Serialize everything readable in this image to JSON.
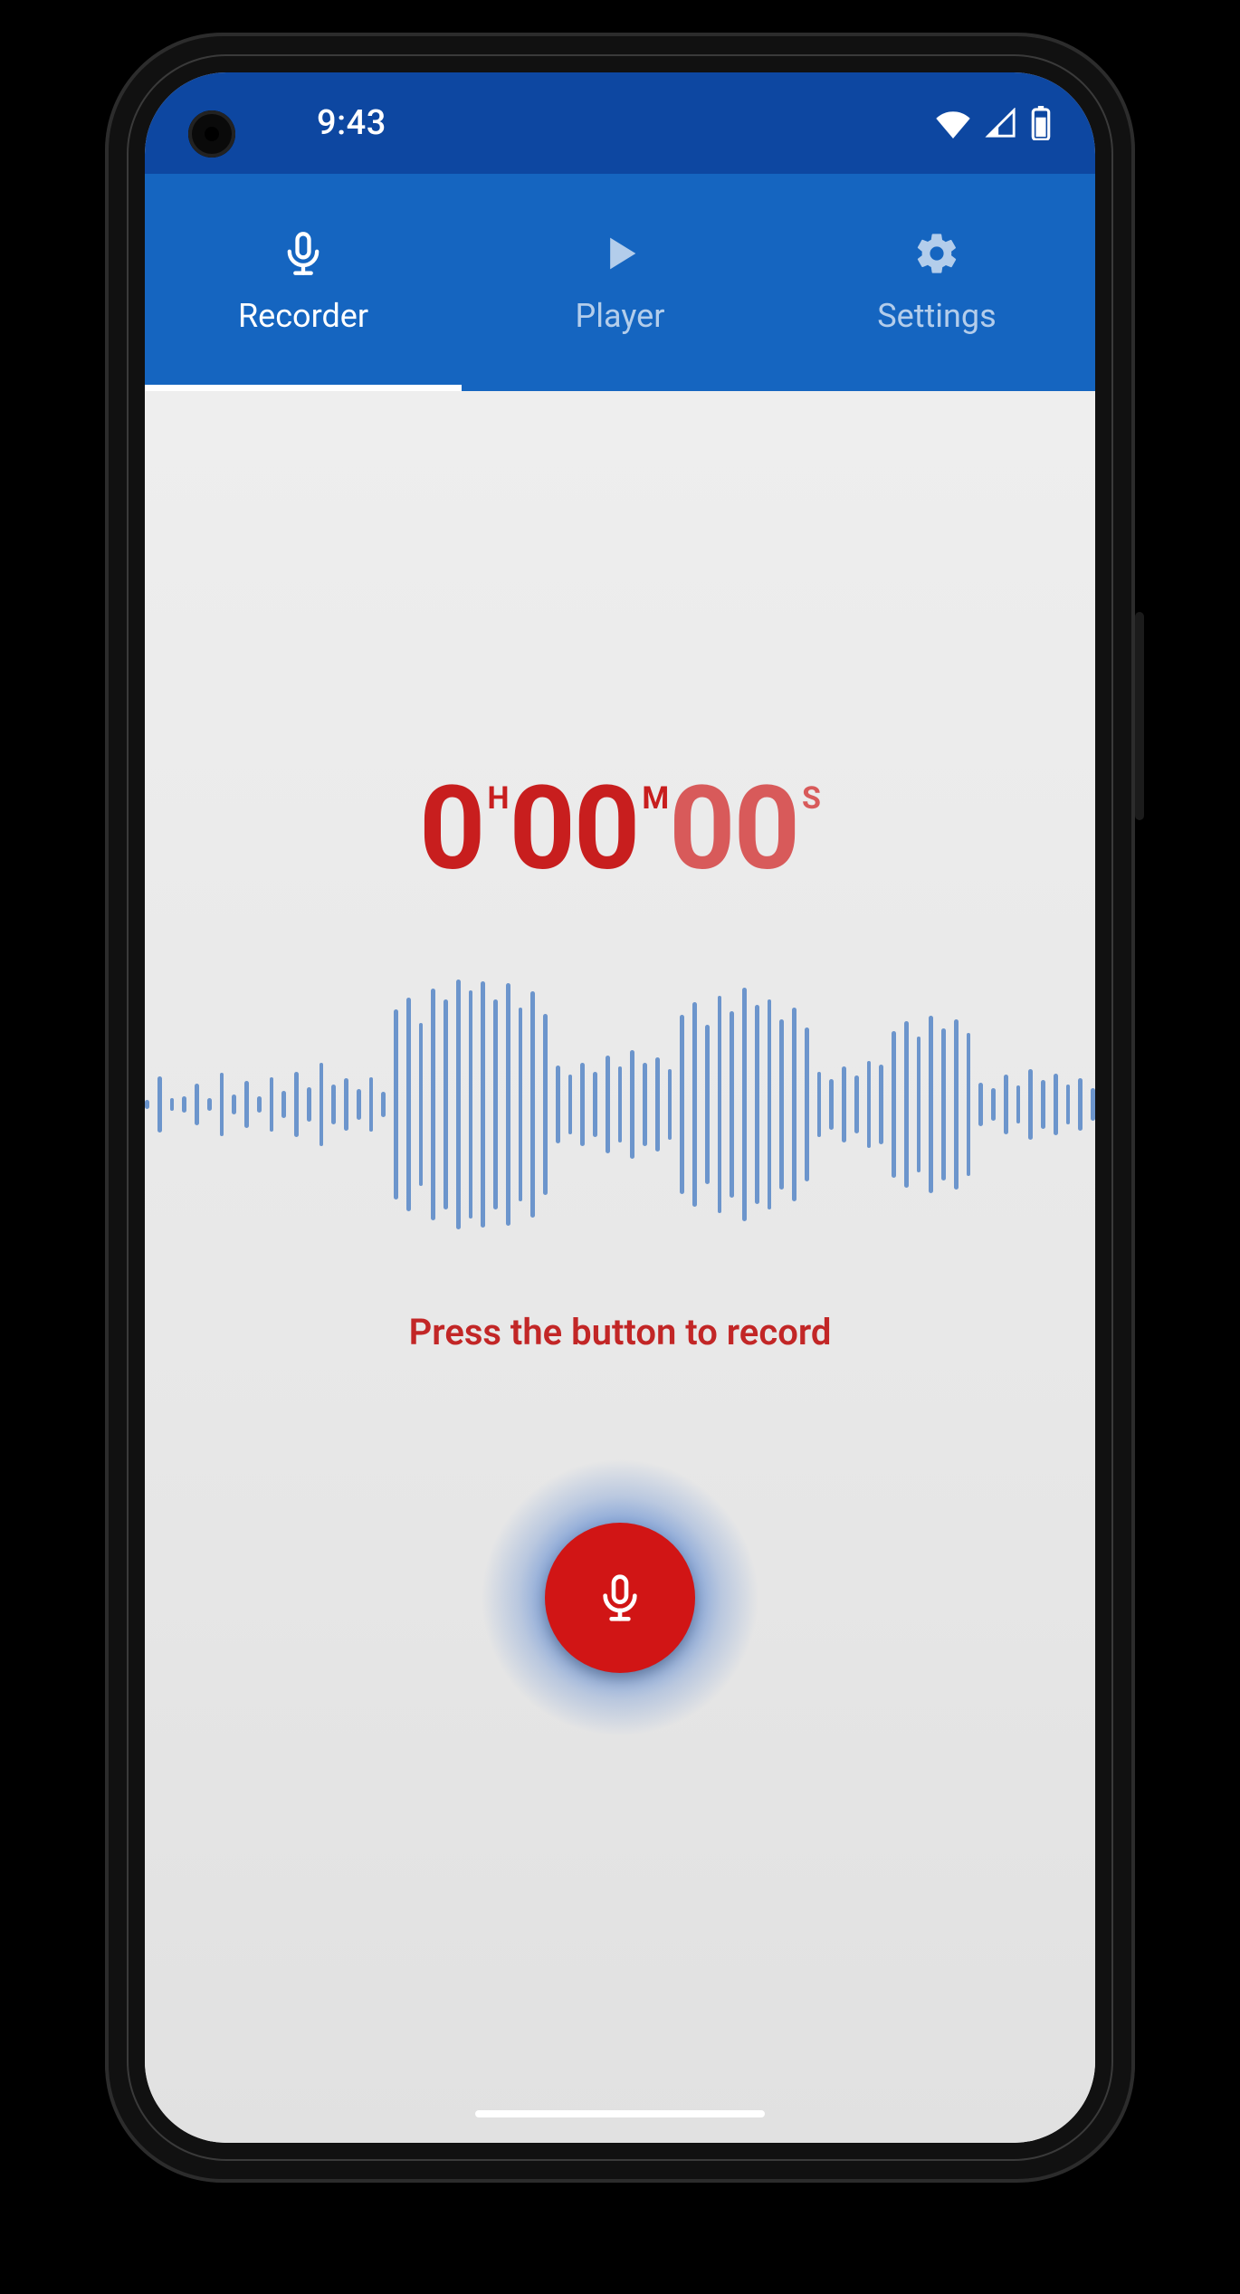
{
  "status": {
    "time": "9:43"
  },
  "tabs": [
    {
      "label": "Recorder",
      "icon": "microphone-icon",
      "active": true
    },
    {
      "label": "Player",
      "icon": "play-icon",
      "active": false
    },
    {
      "label": "Settings",
      "icon": "gear-icon",
      "active": false
    }
  ],
  "timer": {
    "hours": "0",
    "minutes": "00",
    "seconds": "00",
    "unit_h": "H",
    "unit_m": "M",
    "unit_s": "S"
  },
  "hint": "Press the button to record",
  "waveform_bars": [
    10,
    62,
    14,
    18,
    46,
    14,
    70,
    22,
    52,
    18,
    60,
    30,
    72,
    38,
    92,
    44,
    58,
    34,
    60,
    28,
    210,
    236,
    180,
    256,
    232,
    276,
    252,
    272,
    232,
    268,
    214,
    250,
    200,
    86,
    66,
    92,
    72,
    108,
    84,
    120,
    92,
    104,
    78,
    198,
    226,
    176,
    240,
    206,
    258,
    220,
    232,
    188,
    214,
    170,
    72,
    56,
    84,
    64,
    96,
    88,
    162,
    184,
    150,
    196,
    168,
    188,
    158,
    48,
    36,
    66,
    42,
    78,
    54,
    68,
    44,
    58,
    36
  ],
  "colors": {
    "status_bg": "#0d47a1",
    "tab_bg": "#1565c0",
    "accent": "#c81e1e",
    "record": "#d11515",
    "wave_bar": "#6c95cc"
  }
}
